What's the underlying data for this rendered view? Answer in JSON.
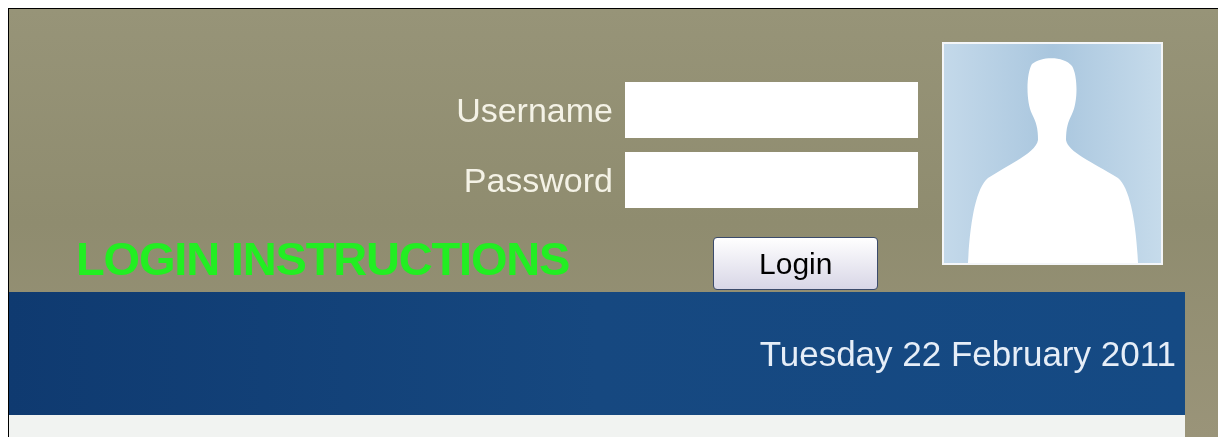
{
  "login_form": {
    "fields": [
      {
        "label": "Username"
      },
      {
        "label": "Password"
      }
    ],
    "instructions_link": "LOGIN INSTRUCTIONS",
    "login_button": "Login"
  },
  "banner": {
    "date": "Tuesday 22 February 2011"
  }
}
